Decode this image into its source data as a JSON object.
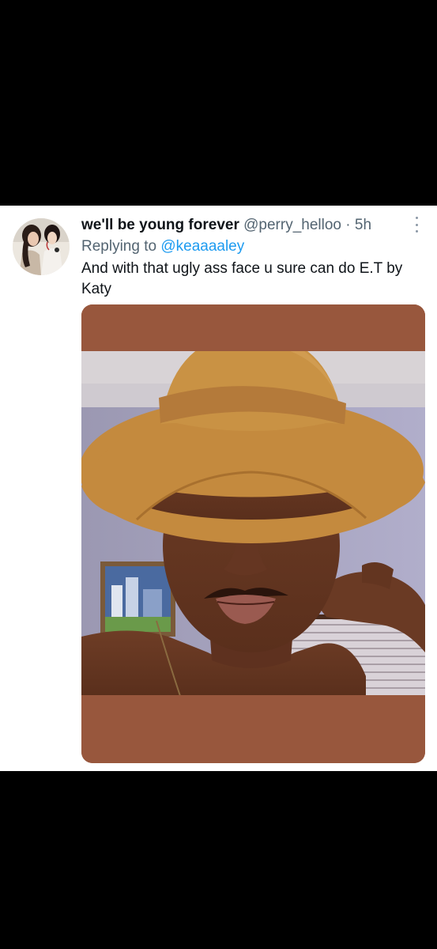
{
  "tweet": {
    "display_name": "we'll be young forever",
    "handle": "@perry_helloo",
    "separator": "·",
    "time": "5h",
    "replying_prefix": "Replying to",
    "replying_to": "@keaaaaley",
    "text": "And with that ugly ass face u sure can do E.T by Katy"
  },
  "icons": {
    "more": "more-vertical-icon",
    "avatar": "profile-avatar"
  },
  "colors": {
    "background": "#000000",
    "card": "#ffffff",
    "link": "#1d9bf0",
    "secondary_text": "#536471",
    "media_frame": "#98573d"
  }
}
